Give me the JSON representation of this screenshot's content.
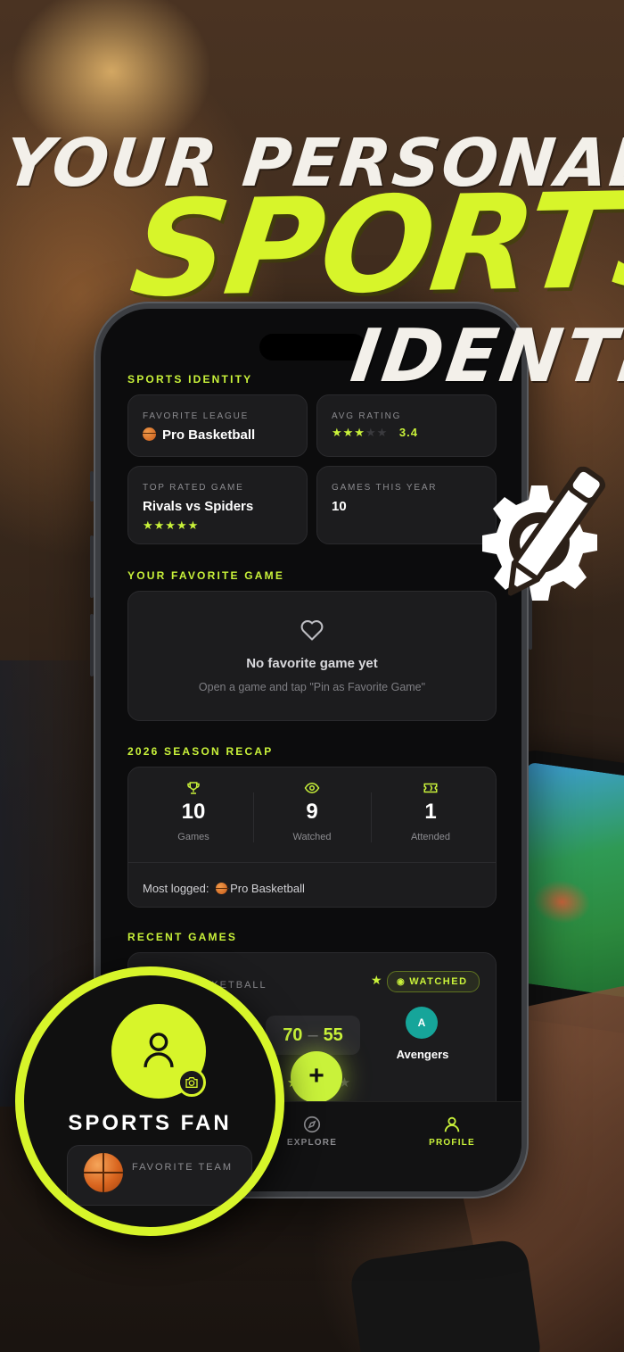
{
  "headline": {
    "line1": "YOUR PERSONAL",
    "line2": "SPORTS",
    "line3": "IDENTITY"
  },
  "sports_identity": {
    "title": "SPORTS IDENTITY",
    "favorite_league": {
      "label": "FAVORITE LEAGUE",
      "value": "Pro Basketball"
    },
    "avg_rating": {
      "label": "AVG RATING",
      "value": "3.4",
      "stars_filled": 3,
      "stars_total": 5
    },
    "top_rated_game": {
      "label": "TOP RATED GAME",
      "value": "Rivals vs Spiders",
      "stars_filled": 5,
      "stars_total": 5
    },
    "games_this_year": {
      "label": "GAMES THIS YEAR",
      "value": "10"
    }
  },
  "favorite_game": {
    "title": "YOUR FAVORITE GAME",
    "empty_title": "No favorite game yet",
    "empty_hint": "Open a game and tap \"Pin as Favorite Game\""
  },
  "season_recap": {
    "title": "2026 SEASON RECAP",
    "stats": [
      {
        "value": "10",
        "label": "Games",
        "icon": "trophy-icon"
      },
      {
        "value": "9",
        "label": "Watched",
        "icon": "eye-icon"
      },
      {
        "value": "1",
        "label": "Attended",
        "icon": "ticket-icon"
      }
    ],
    "most_logged_label": "Most logged:",
    "most_logged_value": "Pro Basketball"
  },
  "recent_games": {
    "title": "RECENT GAMES",
    "game": {
      "league": "SKETBALL",
      "status": "WATCHED",
      "score_home": "70",
      "score_away": "55",
      "score_sep": "–",
      "away_team": "Avengers",
      "away_initial": "A",
      "stars_filled": 2,
      "stars_total": 5
    }
  },
  "fab": {
    "label": "+"
  },
  "tabbar": {
    "explore": "EXPLORE",
    "profile": "PROFILE"
  },
  "profile_overlay": {
    "name": "SPORTS FAN",
    "favorite_team_label": "FAVORITE TEAM"
  },
  "colors": {
    "accent": "#c9f23a",
    "headline_green": "#d7f52a",
    "card_bg": "#1c1c1e",
    "screen_bg": "#0c0c0d",
    "team_badge": "#16a59a"
  }
}
